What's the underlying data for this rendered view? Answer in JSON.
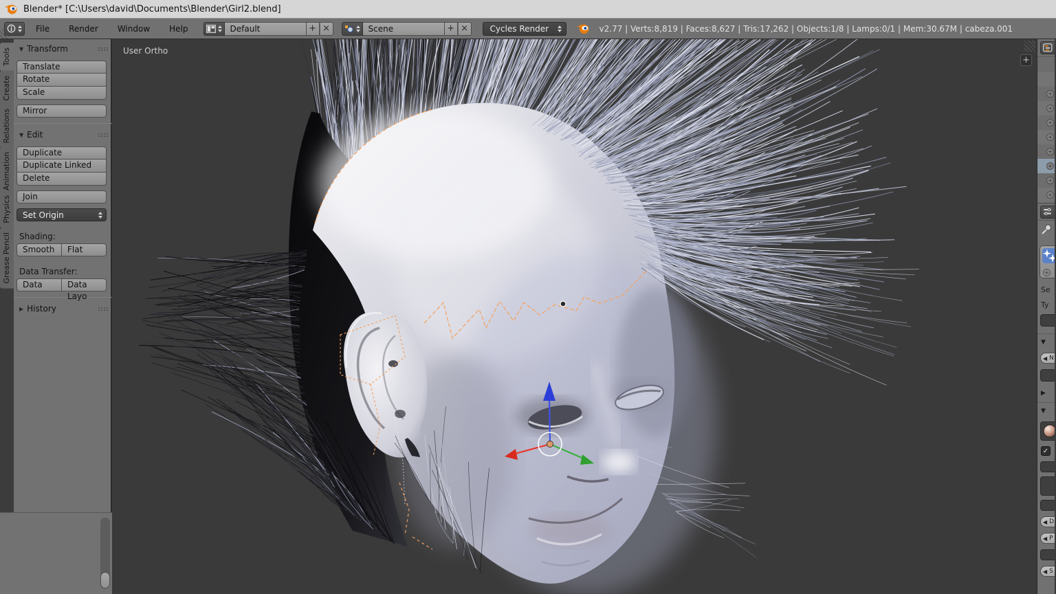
{
  "window": {
    "title": "Blender* [C:\\Users\\david\\Documents\\Blender\\Girl2.blend]"
  },
  "infobar": {
    "menus": [
      {
        "label": "File"
      },
      {
        "label": "Render"
      },
      {
        "label": "Window"
      },
      {
        "label": "Help"
      }
    ],
    "layout": {
      "value": "Default"
    },
    "scene": {
      "value": "Scene"
    },
    "engine": {
      "value": "Cycles Render"
    },
    "stats": "v2.77 | Verts:8,819 | Faces:8,627 | Tris:17,262 | Objects:1/8 | Lamps:0/1 | Mem:30.67M | cabeza.001"
  },
  "toolshelf": {
    "tabs": [
      {
        "label": "Tools",
        "active": true
      },
      {
        "label": "Create",
        "active": false
      },
      {
        "label": "Relations",
        "active": false
      },
      {
        "label": "Animation",
        "active": false
      },
      {
        "label": "Physics",
        "active": false
      },
      {
        "label": "Grease Pencil",
        "active": false
      }
    ],
    "transform": {
      "title": "Transform",
      "translate": "Translate",
      "rotate": "Rotate",
      "scale": "Scale",
      "mirror": "Mirror"
    },
    "edit": {
      "title": "Edit",
      "duplicate": "Duplicate",
      "duplicate_linked": "Duplicate Linked",
      "delete": "Delete",
      "join": "Join",
      "set_origin": "Set Origin",
      "shading_label": "Shading:",
      "smooth": "Smooth",
      "flat": "Flat",
      "data_transfer_label": "Data Transfer:",
      "data": "Data",
      "data_layout": "Data Layo"
    },
    "history": {
      "title": "History"
    }
  },
  "viewport": {
    "view_label": "User Ortho"
  },
  "properties_strip": {
    "fragments": {
      "settings": "Se",
      "type": "Ty",
      "n": "N",
      "d": "D",
      "p": "P",
      "s": "S"
    }
  },
  "icons": {
    "plus": "+",
    "close": "×",
    "tri_down": "▼",
    "tri_right": "▶",
    "check": "✓",
    "circle_plus": "+"
  },
  "colors": {
    "accent_orange": "#e87d0d",
    "selection_orange": "#f5a15f",
    "axis_x": "#e8392b",
    "axis_y": "#3fae3f",
    "axis_z": "#3d51e8"
  }
}
